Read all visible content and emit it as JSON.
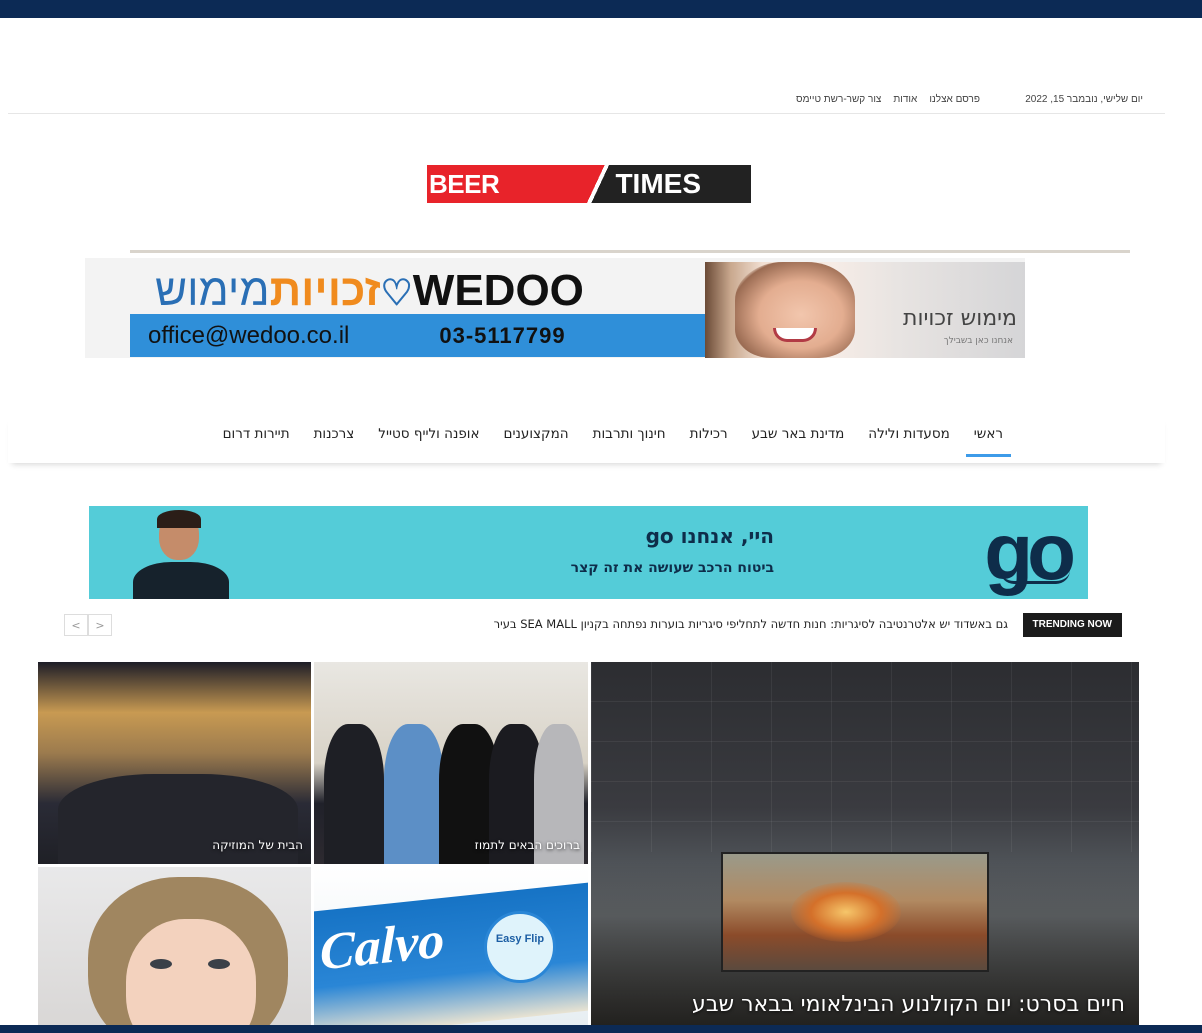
{
  "topbar": {
    "date": "יום שלישי, נובמבר 15, 2022",
    "links": [
      "פרסם אצלנו",
      "אודות",
      "צור קשר-רשת טיימס"
    ]
  },
  "logo": {
    "left": "BEER SHEVA",
    "right": "TIMES"
  },
  "ad_wedoo": {
    "brand_hebrew_1": "זכויות",
    "brand_hebrew_2": "מימוש",
    "brand_latin": "WEDOO",
    "email": "office@wedoo.co.il",
    "phone": "03-5117799",
    "title": "מימוש זכויות",
    "subtitle": "אנחנו כאן בשבילך"
  },
  "nav": {
    "items": [
      {
        "label": "ראשי",
        "active": true
      },
      {
        "label": "מסעדות ולילה",
        "active": false
      },
      {
        "label": "מדינת באר שבע",
        "active": false
      },
      {
        "label": "רכילות",
        "active": false
      },
      {
        "label": "חינוך ותרבות",
        "active": false
      },
      {
        "label": "המקצוענים",
        "active": false
      },
      {
        "label": "אופנה ולייף סטייל",
        "active": false
      },
      {
        "label": "צרכנות",
        "active": false
      },
      {
        "label": "תיירות דרום",
        "active": false
      }
    ]
  },
  "ad_go": {
    "logo": "go",
    "headline": "היי, אנחנו go",
    "sub": "ביטוח הרכב שעושה את זה קצר"
  },
  "trending": {
    "label": "TRENDING NOW",
    "text": "גם באשדוד יש אלטרנטיבה לסיגריות: חנות חדשה לתחליפי סיגריות בוערות נפתחה בקניון SEA MALL בעיר",
    "prev": "<",
    "next": ">"
  },
  "grid": {
    "big_caption": "חיים בסרט: יום הקולנוע הבינלאומי בבאר שבע",
    "tile1_caption": "ברוכים הבאים לתמוז",
    "tile2_caption": "הבית של המוזיקה",
    "tile3_brand": "Calvo",
    "tile3_badge": "Easy Flip"
  },
  "colors": {
    "header_stripe": "#0c2a55",
    "logo_red": "#e8232a",
    "nav_active": "#3d9be9",
    "go_banner": "#54ccd8"
  }
}
